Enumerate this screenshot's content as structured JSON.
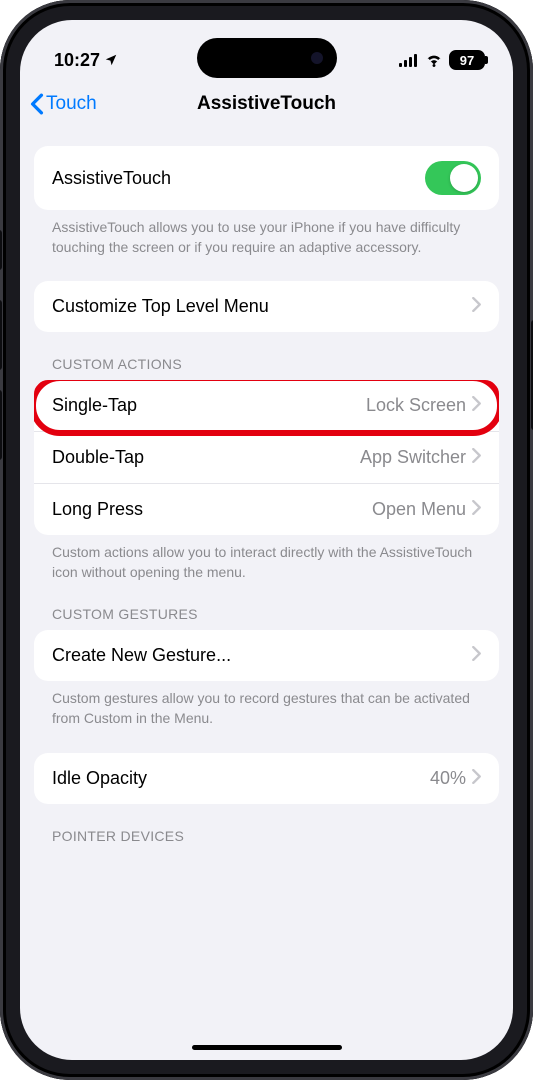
{
  "status": {
    "time": "10:27",
    "battery": "97"
  },
  "nav": {
    "back": "Touch",
    "title": "AssistiveTouch"
  },
  "mainToggle": {
    "label": "AssistiveTouch",
    "footer": "AssistiveTouch allows you to use your iPhone if you have difficulty touching the screen or if you require an adaptive accessory."
  },
  "customizeMenu": {
    "label": "Customize Top Level Menu"
  },
  "customActions": {
    "header": "CUSTOM ACTIONS",
    "rows": [
      {
        "label": "Single-Tap",
        "value": "Lock Screen"
      },
      {
        "label": "Double-Tap",
        "value": "App Switcher"
      },
      {
        "label": "Long Press",
        "value": "Open Menu"
      }
    ],
    "footer": "Custom actions allow you to interact directly with the AssistiveTouch icon without opening the menu."
  },
  "customGestures": {
    "header": "CUSTOM GESTURES",
    "label": "Create New Gesture...",
    "footer": "Custom gestures allow you to record gestures that can be activated from Custom in the Menu."
  },
  "idleOpacity": {
    "label": "Idle Opacity",
    "value": "40%"
  },
  "pointerDevices": {
    "header": "POINTER DEVICES"
  }
}
